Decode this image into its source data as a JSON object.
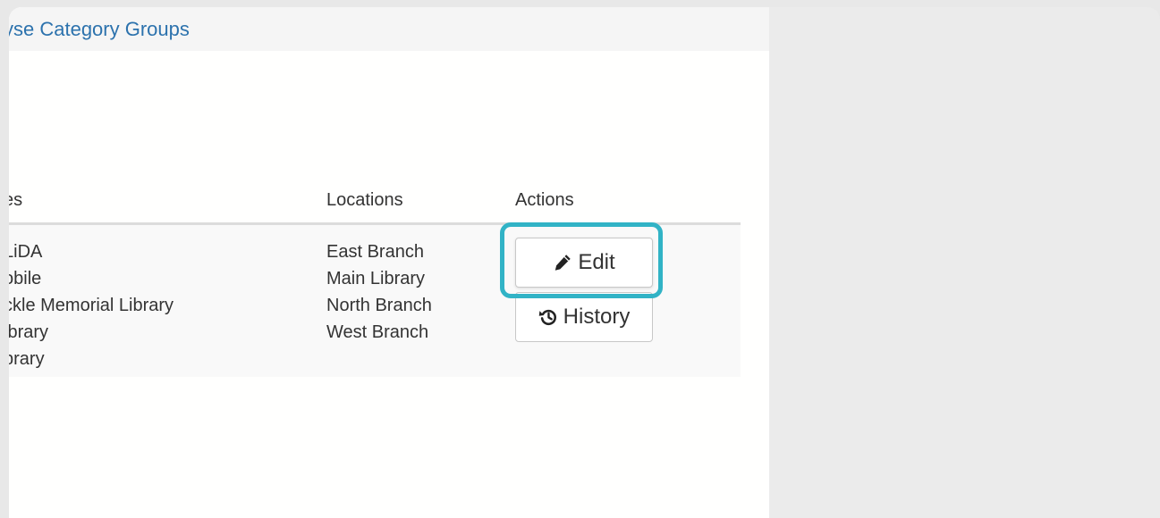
{
  "panel": {
    "title": "yse Category Groups"
  },
  "table": {
    "headers": {
      "col1": "es",
      "locations": "Locations",
      "actions": "Actions"
    },
    "row": {
      "names": [
        " LiDA",
        "obile",
        "ckle Memorial Library",
        "ibrary",
        "brary"
      ],
      "locations": [
        "East Branch",
        "Main Library",
        "North Branch",
        "West Branch"
      ],
      "actions": {
        "edit_label": "Edit",
        "history_label": "History"
      }
    }
  },
  "icons": {
    "edit": "pencil-icon",
    "history": "history-icon"
  },
  "colors": {
    "title": "#2c72ad",
    "highlight": "#31b3c6",
    "right_background": "#ebebeb"
  }
}
